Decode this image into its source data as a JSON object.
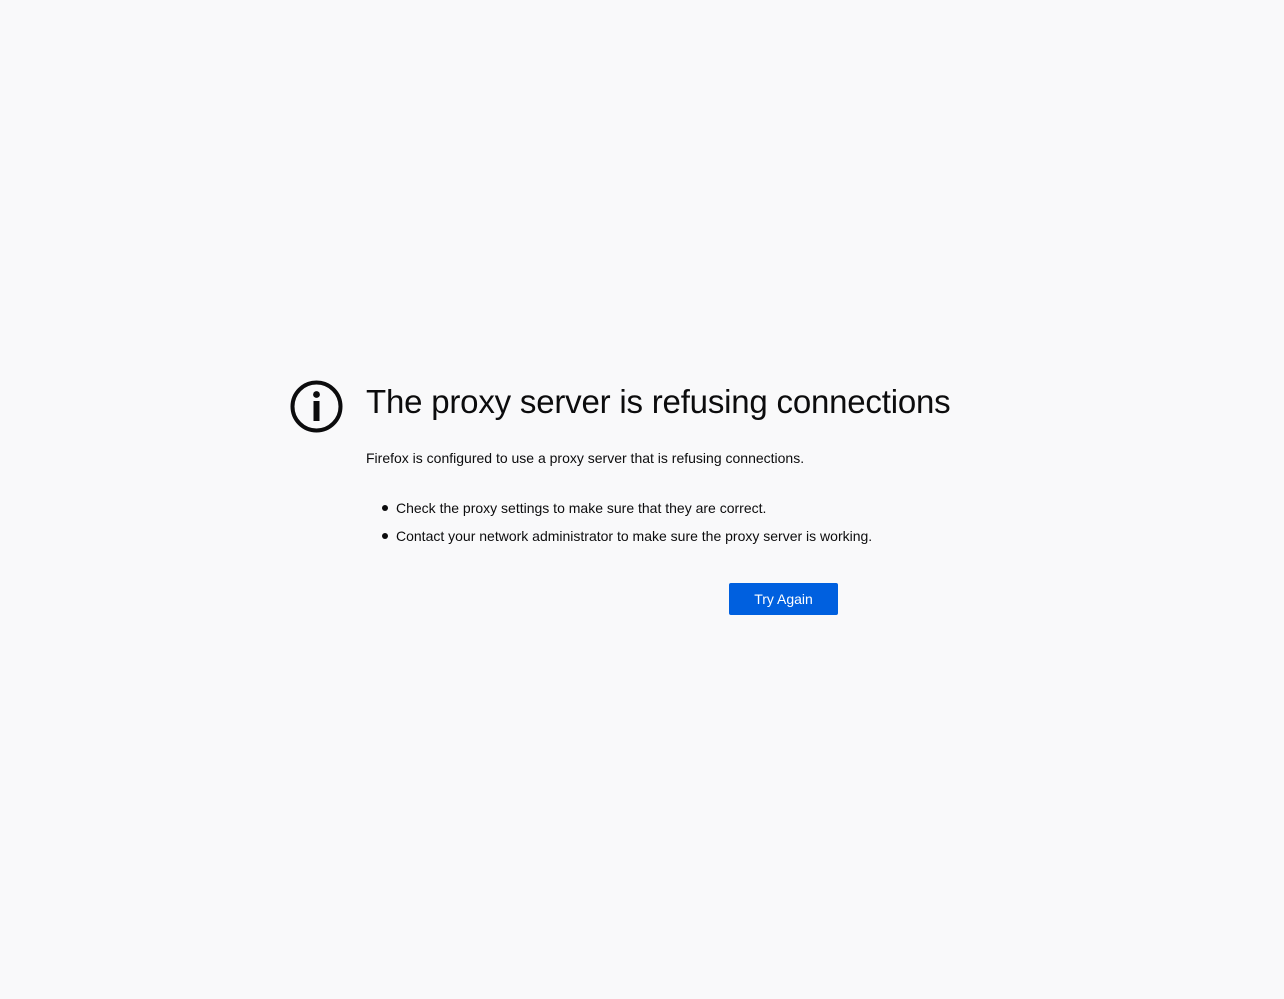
{
  "error": {
    "icon": "info-icon",
    "title": "The proxy server is refusing connections",
    "description": "Firefox is configured to use a proxy server that is refusing connections.",
    "suggestions": [
      "Check the proxy settings to make sure that they are correct.",
      "Contact your network administrator to make sure the proxy server is working."
    ],
    "try_again_label": "Try Again"
  },
  "colors": {
    "background": "#f9f9fa",
    "text": "#0c0c0d",
    "button_primary": "#0060df",
    "button_text": "#ffffff"
  }
}
